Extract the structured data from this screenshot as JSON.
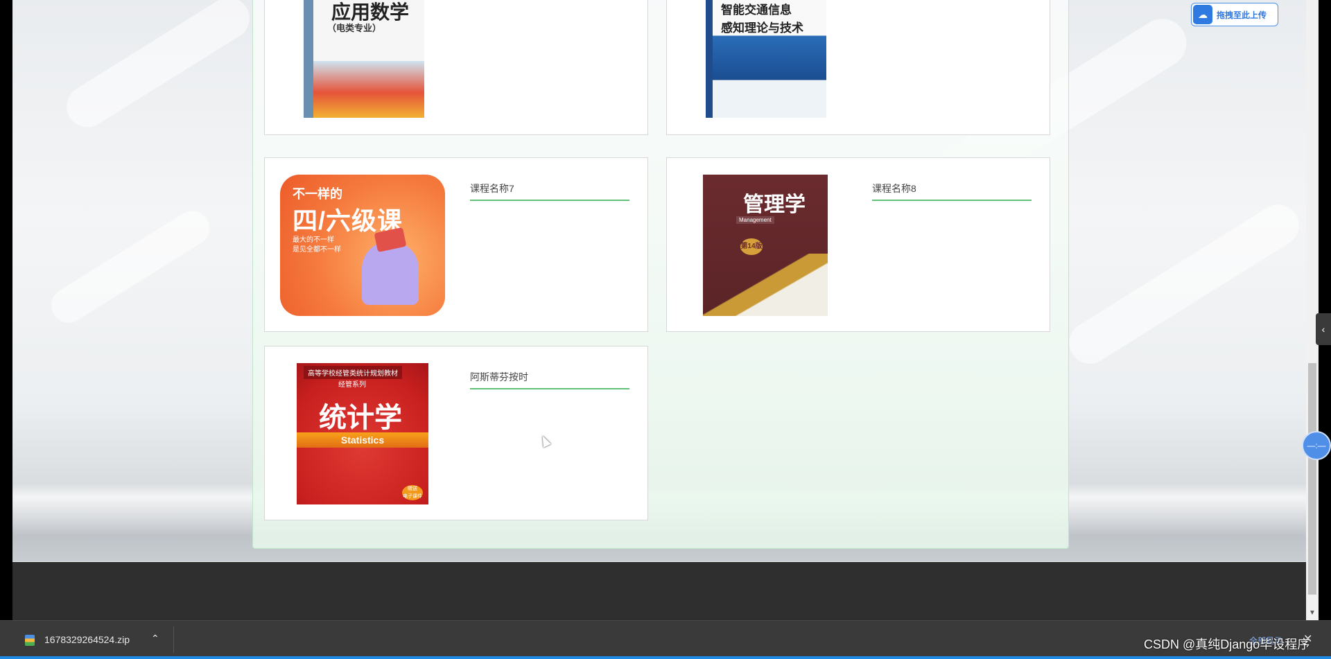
{
  "upload_button": {
    "label": "拖拽至此上传",
    "icon": "cloud-upload-icon"
  },
  "courses": [
    {
      "title": "",
      "cover_title": "应用数学",
      "cover_subtitle": "（电类专业）"
    },
    {
      "title": "",
      "cover_title": "智能交通信息\n感知理论与技术"
    },
    {
      "title": "课程名称7",
      "cover_title_small": "不一样的",
      "cover_title": "四/六级课",
      "cover_tagline": "最大的不一样\n是见全都不一样"
    },
    {
      "title": "课程名称8",
      "cover_title": "管理学",
      "cover_subtitle": "Management",
      "cover_edition": "第14版"
    },
    {
      "title": "阿斯蒂芬按时",
      "cover_top": "高等学校经管类统计规划教材",
      "cover_series": "经管系列",
      "cover_title": "统计学",
      "cover_subtitle": "Statistics",
      "cover_stamp": "赠送\n电子课件"
    }
  ],
  "side_tab": {
    "icon": "chevron-left-icon",
    "glyph": "‹"
  },
  "float_widget": {
    "label": "—:—"
  },
  "download_shelf": {
    "file_name": "1678329264524.zip",
    "show_all": "全部显示",
    "close": "✕"
  },
  "watermark": "CSDN @真纯Django毕设程序"
}
